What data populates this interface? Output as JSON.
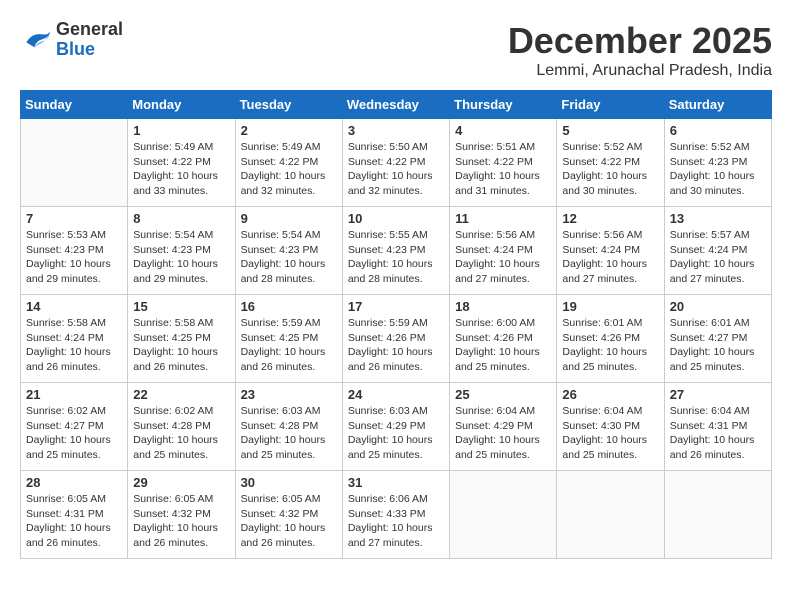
{
  "logo": {
    "line1": "General",
    "line2": "Blue"
  },
  "title": "December 2025",
  "subtitle": "Lemmi, Arunachal Pradesh, India",
  "weekdays": [
    "Sunday",
    "Monday",
    "Tuesday",
    "Wednesday",
    "Thursday",
    "Friday",
    "Saturday"
  ],
  "weeks": [
    [
      {
        "day": "",
        "info": ""
      },
      {
        "day": "1",
        "info": "Sunrise: 5:49 AM\nSunset: 4:22 PM\nDaylight: 10 hours\nand 33 minutes."
      },
      {
        "day": "2",
        "info": "Sunrise: 5:49 AM\nSunset: 4:22 PM\nDaylight: 10 hours\nand 32 minutes."
      },
      {
        "day": "3",
        "info": "Sunrise: 5:50 AM\nSunset: 4:22 PM\nDaylight: 10 hours\nand 32 minutes."
      },
      {
        "day": "4",
        "info": "Sunrise: 5:51 AM\nSunset: 4:22 PM\nDaylight: 10 hours\nand 31 minutes."
      },
      {
        "day": "5",
        "info": "Sunrise: 5:52 AM\nSunset: 4:22 PM\nDaylight: 10 hours\nand 30 minutes."
      },
      {
        "day": "6",
        "info": "Sunrise: 5:52 AM\nSunset: 4:23 PM\nDaylight: 10 hours\nand 30 minutes."
      }
    ],
    [
      {
        "day": "7",
        "info": "Sunrise: 5:53 AM\nSunset: 4:23 PM\nDaylight: 10 hours\nand 29 minutes."
      },
      {
        "day": "8",
        "info": "Sunrise: 5:54 AM\nSunset: 4:23 PM\nDaylight: 10 hours\nand 29 minutes."
      },
      {
        "day": "9",
        "info": "Sunrise: 5:54 AM\nSunset: 4:23 PM\nDaylight: 10 hours\nand 28 minutes."
      },
      {
        "day": "10",
        "info": "Sunrise: 5:55 AM\nSunset: 4:23 PM\nDaylight: 10 hours\nand 28 minutes."
      },
      {
        "day": "11",
        "info": "Sunrise: 5:56 AM\nSunset: 4:24 PM\nDaylight: 10 hours\nand 27 minutes."
      },
      {
        "day": "12",
        "info": "Sunrise: 5:56 AM\nSunset: 4:24 PM\nDaylight: 10 hours\nand 27 minutes."
      },
      {
        "day": "13",
        "info": "Sunrise: 5:57 AM\nSunset: 4:24 PM\nDaylight: 10 hours\nand 27 minutes."
      }
    ],
    [
      {
        "day": "14",
        "info": "Sunrise: 5:58 AM\nSunset: 4:24 PM\nDaylight: 10 hours\nand 26 minutes."
      },
      {
        "day": "15",
        "info": "Sunrise: 5:58 AM\nSunset: 4:25 PM\nDaylight: 10 hours\nand 26 minutes."
      },
      {
        "day": "16",
        "info": "Sunrise: 5:59 AM\nSunset: 4:25 PM\nDaylight: 10 hours\nand 26 minutes."
      },
      {
        "day": "17",
        "info": "Sunrise: 5:59 AM\nSunset: 4:26 PM\nDaylight: 10 hours\nand 26 minutes."
      },
      {
        "day": "18",
        "info": "Sunrise: 6:00 AM\nSunset: 4:26 PM\nDaylight: 10 hours\nand 25 minutes."
      },
      {
        "day": "19",
        "info": "Sunrise: 6:01 AM\nSunset: 4:26 PM\nDaylight: 10 hours\nand 25 minutes."
      },
      {
        "day": "20",
        "info": "Sunrise: 6:01 AM\nSunset: 4:27 PM\nDaylight: 10 hours\nand 25 minutes."
      }
    ],
    [
      {
        "day": "21",
        "info": "Sunrise: 6:02 AM\nSunset: 4:27 PM\nDaylight: 10 hours\nand 25 minutes."
      },
      {
        "day": "22",
        "info": "Sunrise: 6:02 AM\nSunset: 4:28 PM\nDaylight: 10 hours\nand 25 minutes."
      },
      {
        "day": "23",
        "info": "Sunrise: 6:03 AM\nSunset: 4:28 PM\nDaylight: 10 hours\nand 25 minutes."
      },
      {
        "day": "24",
        "info": "Sunrise: 6:03 AM\nSunset: 4:29 PM\nDaylight: 10 hours\nand 25 minutes."
      },
      {
        "day": "25",
        "info": "Sunrise: 6:04 AM\nSunset: 4:29 PM\nDaylight: 10 hours\nand 25 minutes."
      },
      {
        "day": "26",
        "info": "Sunrise: 6:04 AM\nSunset: 4:30 PM\nDaylight: 10 hours\nand 25 minutes."
      },
      {
        "day": "27",
        "info": "Sunrise: 6:04 AM\nSunset: 4:31 PM\nDaylight: 10 hours\nand 26 minutes."
      }
    ],
    [
      {
        "day": "28",
        "info": "Sunrise: 6:05 AM\nSunset: 4:31 PM\nDaylight: 10 hours\nand 26 minutes."
      },
      {
        "day": "29",
        "info": "Sunrise: 6:05 AM\nSunset: 4:32 PM\nDaylight: 10 hours\nand 26 minutes."
      },
      {
        "day": "30",
        "info": "Sunrise: 6:05 AM\nSunset: 4:32 PM\nDaylight: 10 hours\nand 26 minutes."
      },
      {
        "day": "31",
        "info": "Sunrise: 6:06 AM\nSunset: 4:33 PM\nDaylight: 10 hours\nand 27 minutes."
      },
      {
        "day": "",
        "info": ""
      },
      {
        "day": "",
        "info": ""
      },
      {
        "day": "",
        "info": ""
      }
    ]
  ]
}
